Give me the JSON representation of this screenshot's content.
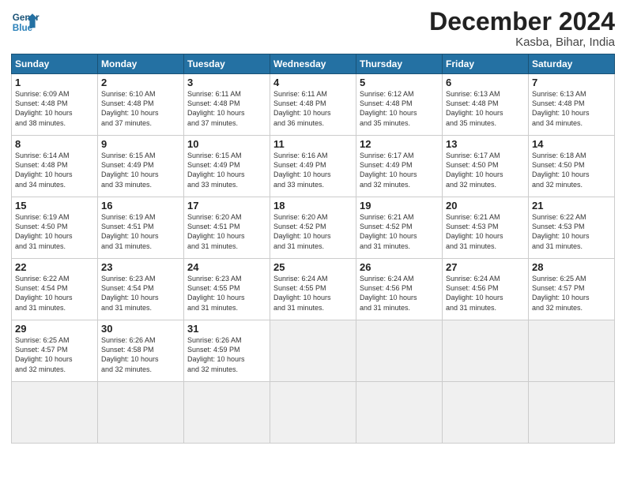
{
  "header": {
    "logo_line1": "General",
    "logo_line2": "Blue",
    "month_title": "December 2024",
    "location": "Kasba, Bihar, India"
  },
  "weekdays": [
    "Sunday",
    "Monday",
    "Tuesday",
    "Wednesday",
    "Thursday",
    "Friday",
    "Saturday"
  ],
  "days": [
    {
      "num": "",
      "info": ""
    },
    {
      "num": "",
      "info": ""
    },
    {
      "num": "",
      "info": ""
    },
    {
      "num": "",
      "info": ""
    },
    {
      "num": "",
      "info": ""
    },
    {
      "num": "",
      "info": ""
    },
    {
      "num": "",
      "info": ""
    },
    {
      "num": "1",
      "info": "Sunrise: 6:09 AM\nSunset: 4:48 PM\nDaylight: 10 hours\nand 38 minutes."
    },
    {
      "num": "2",
      "info": "Sunrise: 6:10 AM\nSunset: 4:48 PM\nDaylight: 10 hours\nand 37 minutes."
    },
    {
      "num": "3",
      "info": "Sunrise: 6:11 AM\nSunset: 4:48 PM\nDaylight: 10 hours\nand 37 minutes."
    },
    {
      "num": "4",
      "info": "Sunrise: 6:11 AM\nSunset: 4:48 PM\nDaylight: 10 hours\nand 36 minutes."
    },
    {
      "num": "5",
      "info": "Sunrise: 6:12 AM\nSunset: 4:48 PM\nDaylight: 10 hours\nand 35 minutes."
    },
    {
      "num": "6",
      "info": "Sunrise: 6:13 AM\nSunset: 4:48 PM\nDaylight: 10 hours\nand 35 minutes."
    },
    {
      "num": "7",
      "info": "Sunrise: 6:13 AM\nSunset: 4:48 PM\nDaylight: 10 hours\nand 34 minutes."
    },
    {
      "num": "8",
      "info": "Sunrise: 6:14 AM\nSunset: 4:48 PM\nDaylight: 10 hours\nand 34 minutes."
    },
    {
      "num": "9",
      "info": "Sunrise: 6:15 AM\nSunset: 4:49 PM\nDaylight: 10 hours\nand 33 minutes."
    },
    {
      "num": "10",
      "info": "Sunrise: 6:15 AM\nSunset: 4:49 PM\nDaylight: 10 hours\nand 33 minutes."
    },
    {
      "num": "11",
      "info": "Sunrise: 6:16 AM\nSunset: 4:49 PM\nDaylight: 10 hours\nand 33 minutes."
    },
    {
      "num": "12",
      "info": "Sunrise: 6:17 AM\nSunset: 4:49 PM\nDaylight: 10 hours\nand 32 minutes."
    },
    {
      "num": "13",
      "info": "Sunrise: 6:17 AM\nSunset: 4:50 PM\nDaylight: 10 hours\nand 32 minutes."
    },
    {
      "num": "14",
      "info": "Sunrise: 6:18 AM\nSunset: 4:50 PM\nDaylight: 10 hours\nand 32 minutes."
    },
    {
      "num": "15",
      "info": "Sunrise: 6:19 AM\nSunset: 4:50 PM\nDaylight: 10 hours\nand 31 minutes."
    },
    {
      "num": "16",
      "info": "Sunrise: 6:19 AM\nSunset: 4:51 PM\nDaylight: 10 hours\nand 31 minutes."
    },
    {
      "num": "17",
      "info": "Sunrise: 6:20 AM\nSunset: 4:51 PM\nDaylight: 10 hours\nand 31 minutes."
    },
    {
      "num": "18",
      "info": "Sunrise: 6:20 AM\nSunset: 4:52 PM\nDaylight: 10 hours\nand 31 minutes."
    },
    {
      "num": "19",
      "info": "Sunrise: 6:21 AM\nSunset: 4:52 PM\nDaylight: 10 hours\nand 31 minutes."
    },
    {
      "num": "20",
      "info": "Sunrise: 6:21 AM\nSunset: 4:53 PM\nDaylight: 10 hours\nand 31 minutes."
    },
    {
      "num": "21",
      "info": "Sunrise: 6:22 AM\nSunset: 4:53 PM\nDaylight: 10 hours\nand 31 minutes."
    },
    {
      "num": "22",
      "info": "Sunrise: 6:22 AM\nSunset: 4:54 PM\nDaylight: 10 hours\nand 31 minutes."
    },
    {
      "num": "23",
      "info": "Sunrise: 6:23 AM\nSunset: 4:54 PM\nDaylight: 10 hours\nand 31 minutes."
    },
    {
      "num": "24",
      "info": "Sunrise: 6:23 AM\nSunset: 4:55 PM\nDaylight: 10 hours\nand 31 minutes."
    },
    {
      "num": "25",
      "info": "Sunrise: 6:24 AM\nSunset: 4:55 PM\nDaylight: 10 hours\nand 31 minutes."
    },
    {
      "num": "26",
      "info": "Sunrise: 6:24 AM\nSunset: 4:56 PM\nDaylight: 10 hours\nand 31 minutes."
    },
    {
      "num": "27",
      "info": "Sunrise: 6:24 AM\nSunset: 4:56 PM\nDaylight: 10 hours\nand 31 minutes."
    },
    {
      "num": "28",
      "info": "Sunrise: 6:25 AM\nSunset: 4:57 PM\nDaylight: 10 hours\nand 32 minutes."
    },
    {
      "num": "29",
      "info": "Sunrise: 6:25 AM\nSunset: 4:57 PM\nDaylight: 10 hours\nand 32 minutes."
    },
    {
      "num": "30",
      "info": "Sunrise: 6:26 AM\nSunset: 4:58 PM\nDaylight: 10 hours\nand 32 minutes."
    },
    {
      "num": "31",
      "info": "Sunrise: 6:26 AM\nSunset: 4:59 PM\nDaylight: 10 hours\nand 32 minutes."
    },
    {
      "num": "",
      "info": ""
    },
    {
      "num": "",
      "info": ""
    },
    {
      "num": "",
      "info": ""
    },
    {
      "num": "",
      "info": ""
    }
  ]
}
